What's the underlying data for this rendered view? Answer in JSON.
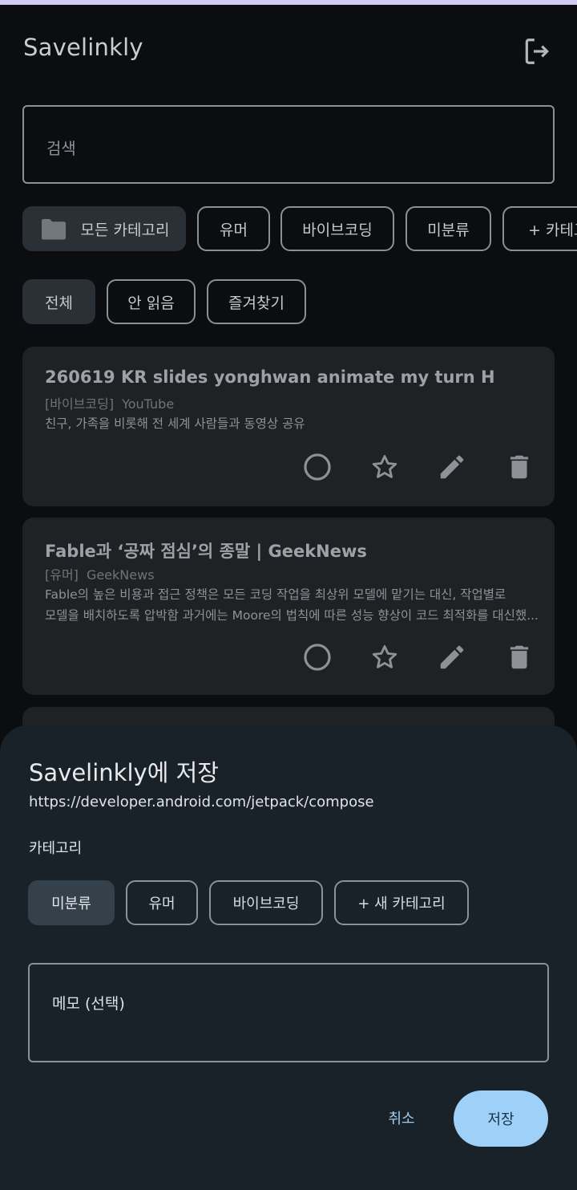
{
  "header": {
    "title": "Savelinkly",
    "logout_icon": "logout-icon"
  },
  "search": {
    "placeholder": "검색"
  },
  "category_filters": [
    {
      "label": "모든 카테고리",
      "icon": "folder-icon",
      "selected": true
    },
    {
      "label": "유머",
      "selected": false
    },
    {
      "label": "바이브코딩",
      "selected": false
    },
    {
      "label": "미분류",
      "selected": false
    },
    {
      "label": "+ 카테고리",
      "selected": false
    }
  ],
  "status_filters": [
    {
      "label": "전체",
      "selected": true
    },
    {
      "label": "안 읽음",
      "selected": false
    },
    {
      "label": "즐겨찾기",
      "selected": false
    }
  ],
  "links": [
    {
      "title": "260619 KR slides yonghwan animate my turn H",
      "category": "[바이브코딩]",
      "source": "YouTube",
      "description": [
        "친구, 가족을 비롯해 전 세계 사람들과 동영상 공유"
      ]
    },
    {
      "title": "Fable과 ‘공짜 점심’의 종말 | GeekNews",
      "category": "[유머]",
      "source": "GeekNews",
      "description": [
        "Fable의 높은 비용과 접근 정책은 모든 코딩 작업을 최상위 모델에 맡기는 대신, 작업별로",
        "모델을 배치하도록 압박함 과거에는 Moore의 법칙에 따른 성능 향상이 코드 최적화를 대신했..."
      ]
    }
  ],
  "sheet": {
    "title": "Savelinkly에 저장",
    "url": "https://developer.android.com/jetpack/compose",
    "category_label": "카테고리",
    "categories": [
      {
        "label": "미분류",
        "selected": true
      },
      {
        "label": "유머",
        "selected": false
      },
      {
        "label": "바이브코딩",
        "selected": false
      },
      {
        "label": "+ 새 카테고리",
        "selected": false
      }
    ],
    "memo_placeholder": "메모 (선택)",
    "cancel_label": "취소",
    "save_label": "저장"
  },
  "colors": {
    "background": "#0b0d10",
    "card": "#1f2124",
    "sheet": "#1a2229",
    "accent": "#9fd0f8",
    "status_strip": "#d4cdf2"
  }
}
